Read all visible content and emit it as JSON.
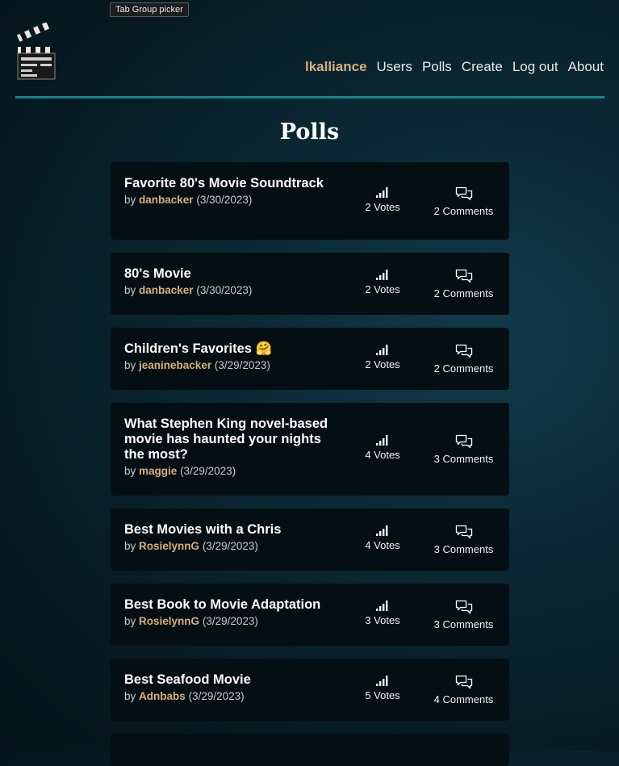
{
  "browser": {
    "tooltip": "Tab Group picker"
  },
  "nav": {
    "username": "lkalliance",
    "items": [
      "Users",
      "Polls",
      "Create",
      "Log out",
      "About"
    ]
  },
  "page": {
    "title": "Polls"
  },
  "polls": [
    {
      "question": "Favorite 80's Movie Soundtrack",
      "by": "by",
      "author": "danbacker",
      "date": "(3/30/2023)",
      "votes": "2 Votes",
      "comments": "2 Comments"
    },
    {
      "question": "80's Movie",
      "by": "by",
      "author": "danbacker",
      "date": "(3/30/2023)",
      "votes": "2 Votes",
      "comments": "2 Comments"
    },
    {
      "question": "Children's Favorites 🤗",
      "by": "by",
      "author": "jeaninebacker",
      "date": "(3/29/2023)",
      "votes": "2 Votes",
      "comments": "2 Comments"
    },
    {
      "question": "What Stephen King novel-based movie has haunted your nights the most?",
      "by": "by",
      "author": "maggie",
      "date": "(3/29/2023)",
      "votes": "4 Votes",
      "comments": "3 Comments"
    },
    {
      "question": "Best Movies with a Chris",
      "by": "by",
      "author": "RosielynnG",
      "date": "(3/29/2023)",
      "votes": "4 Votes",
      "comments": "3 Comments"
    },
    {
      "question": "Best Book to Movie Adaptation",
      "by": "by",
      "author": "RosielynnG",
      "date": "(3/29/2023)",
      "votes": "3 Votes",
      "comments": "3 Comments"
    },
    {
      "question": "Best Seafood Movie",
      "by": "by",
      "author": "Adnbabs",
      "date": "(3/29/2023)",
      "votes": "5 Votes",
      "comments": "4 Comments"
    }
  ]
}
